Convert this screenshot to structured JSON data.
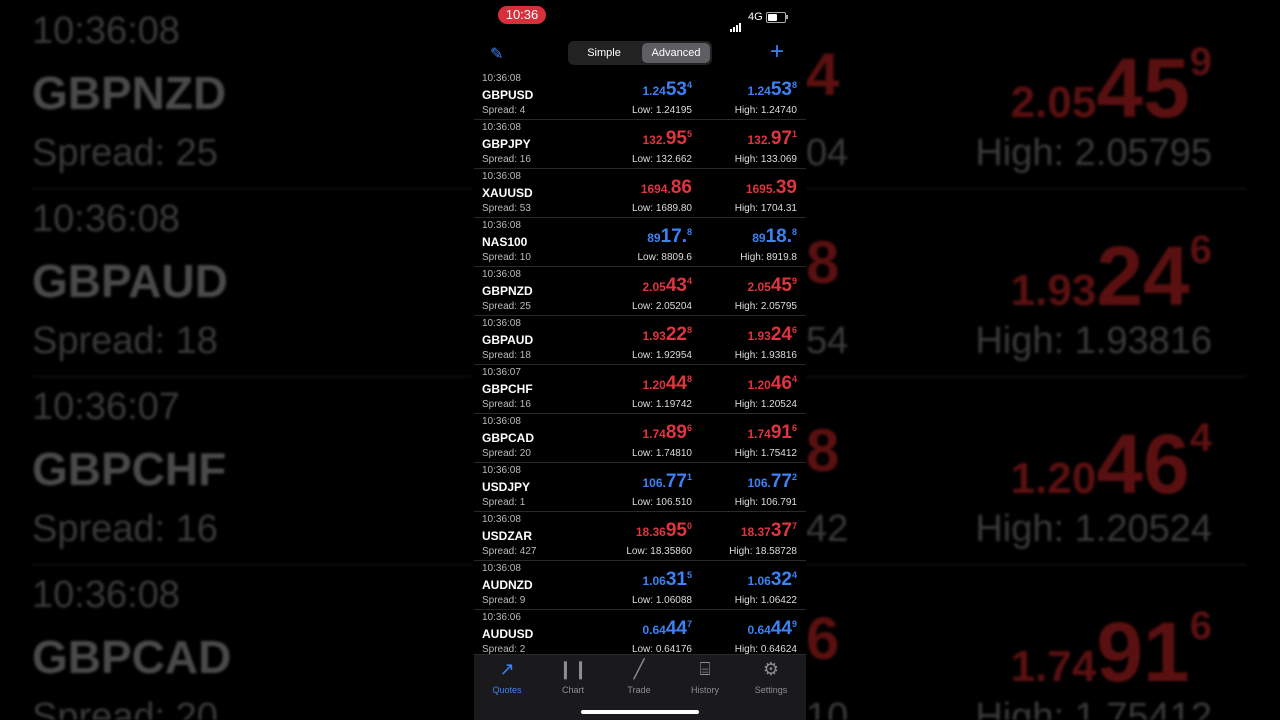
{
  "status": {
    "time": "10:36",
    "network": "4G"
  },
  "nav": {
    "segments": [
      "Simple",
      "Advanced"
    ],
    "active": "Advanced"
  },
  "colors": {
    "up": "#3b82f6",
    "down": "#e0343f",
    "accent": "#3b82f6"
  },
  "quotes": [
    {
      "time": "10:36:08",
      "symbol": "GBPUSD",
      "spread": "Spread: 4",
      "color": "blue",
      "bid": {
        "s": "1.24",
        "b": "53",
        "t": "4"
      },
      "ask": {
        "s": "1.24",
        "b": "53",
        "t": "8"
      },
      "low": "Low: 1.24195",
      "high": "High: 1.24740"
    },
    {
      "time": "10:36:08",
      "symbol": "GBPJPY",
      "spread": "Spread: 16",
      "color": "red",
      "bid": {
        "s": "132.",
        "b": "95",
        "t": "5"
      },
      "ask": {
        "s": "132.",
        "b": "97",
        "t": "1"
      },
      "low": "Low: 132.662",
      "high": "High: 133.069"
    },
    {
      "time": "10:36:08",
      "symbol": "XAUUSD",
      "spread": "Spread: 53",
      "color": "red",
      "bid": {
        "s": "1694.",
        "b": "86",
        "t": ""
      },
      "ask": {
        "s": "1695.",
        "b": "39",
        "t": ""
      },
      "low": "Low: 1689.80",
      "high": "High: 1704.31"
    },
    {
      "time": "10:36:08",
      "symbol": "NAS100",
      "spread": "Spread: 10",
      "color": "blue",
      "bid": {
        "s": "89",
        "b": "17.",
        "t": "8"
      },
      "ask": {
        "s": "89",
        "b": "18.",
        "t": "8"
      },
      "low": "Low: 8809.6",
      "high": "High: 8919.8"
    },
    {
      "time": "10:36:08",
      "symbol": "GBPNZD",
      "spread": "Spread: 25",
      "color": "red",
      "bid": {
        "s": "2.05",
        "b": "43",
        "t": "4"
      },
      "ask": {
        "s": "2.05",
        "b": "45",
        "t": "9"
      },
      "low": "Low: 2.05204",
      "high": "High: 2.05795"
    },
    {
      "time": "10:36:08",
      "symbol": "GBPAUD",
      "spread": "Spread: 18",
      "color": "red",
      "bid": {
        "s": "1.93",
        "b": "22",
        "t": "8"
      },
      "ask": {
        "s": "1.93",
        "b": "24",
        "t": "6"
      },
      "low": "Low: 1.92954",
      "high": "High: 1.93816"
    },
    {
      "time": "10:36:07",
      "symbol": "GBPCHF",
      "spread": "Spread: 16",
      "color": "red",
      "bid": {
        "s": "1.20",
        "b": "44",
        "t": "8"
      },
      "ask": {
        "s": "1.20",
        "b": "46",
        "t": "4"
      },
      "low": "Low: 1.19742",
      "high": "High: 1.20524"
    },
    {
      "time": "10:36:08",
      "symbol": "GBPCAD",
      "spread": "Spread: 20",
      "color": "red",
      "bid": {
        "s": "1.74",
        "b": "89",
        "t": "6"
      },
      "ask": {
        "s": "1.74",
        "b": "91",
        "t": "6"
      },
      "low": "Low: 1.74810",
      "high": "High: 1.75412"
    },
    {
      "time": "10:36:08",
      "symbol": "USDJPY",
      "spread": "Spread: 1",
      "color": "blue",
      "bid": {
        "s": "106.",
        "b": "77",
        "t": "1"
      },
      "ask": {
        "s": "106.",
        "b": "77",
        "t": "2"
      },
      "low": "Low: 106.510",
      "high": "High: 106.791"
    },
    {
      "time": "10:36:08",
      "symbol": "USDZAR",
      "spread": "Spread: 427",
      "color": "red",
      "bid": {
        "s": "18.36",
        "b": "95",
        "t": "0"
      },
      "ask": {
        "s": "18.37",
        "b": "37",
        "t": "7"
      },
      "low": "Low: 18.35860",
      "high": "High: 18.58728"
    },
    {
      "time": "10:36:08",
      "symbol": "AUDNZD",
      "spread": "Spread: 9",
      "color": "blue",
      "bid": {
        "s": "1.06",
        "b": "31",
        "t": "5"
      },
      "ask": {
        "s": "1.06",
        "b": "32",
        "t": "4"
      },
      "low": "Low: 1.06088",
      "high": "High: 1.06422"
    },
    {
      "time": "10:36:06",
      "symbol": "AUDUSD",
      "spread": "Spread: 2",
      "color": "blue",
      "bid": {
        "s": "0.64",
        "b": "44",
        "t": "7"
      },
      "ask": {
        "s": "0.64",
        "b": "44",
        "t": "9"
      },
      "low": "Low: 0.64176",
      "high": "High: 0.64624"
    }
  ],
  "tabs": [
    {
      "label": "Quotes",
      "icon": "quotes-icon",
      "active": true
    },
    {
      "label": "Chart",
      "icon": "chart-icon",
      "active": false
    },
    {
      "label": "Trade",
      "icon": "trade-icon",
      "active": false
    },
    {
      "label": "History",
      "icon": "history-icon",
      "active": false
    },
    {
      "label": "Settings",
      "icon": "settings-icon",
      "active": false
    }
  ],
  "background": {
    "left": [
      {
        "time": "10:36:08",
        "symbol": "GBPNZD",
        "spread": "Spread: 25"
      },
      {
        "time": "10:36:08",
        "symbol": "GBPAUD",
        "spread": "Spread: 18"
      },
      {
        "time": "10:36:07",
        "symbol": "GBPCHF",
        "spread": "Spread: 16"
      },
      {
        "time": "10:36:08",
        "symbol": "GBPCAD",
        "spread": "Spread: 20"
      }
    ],
    "right": [
      {
        "price": {
          "s": "2.05",
          "b": "45",
          "t": "9"
        },
        "high": "High: 2.05795",
        "edge": "4",
        "edge2": "04"
      },
      {
        "price": {
          "s": "1.93",
          "b": "24",
          "t": "6"
        },
        "high": "High: 1.93816",
        "edge": "8",
        "edge2": "54"
      },
      {
        "price": {
          "s": "1.20",
          "b": "46",
          "t": "4"
        },
        "high": "High: 1.20524",
        "edge": "8",
        "edge2": "42"
      },
      {
        "price": {
          "s": "1.74",
          "b": "91",
          "t": "6"
        },
        "high": "High: 1.75412",
        "edge": "6",
        "edge2": "10"
      }
    ]
  }
}
